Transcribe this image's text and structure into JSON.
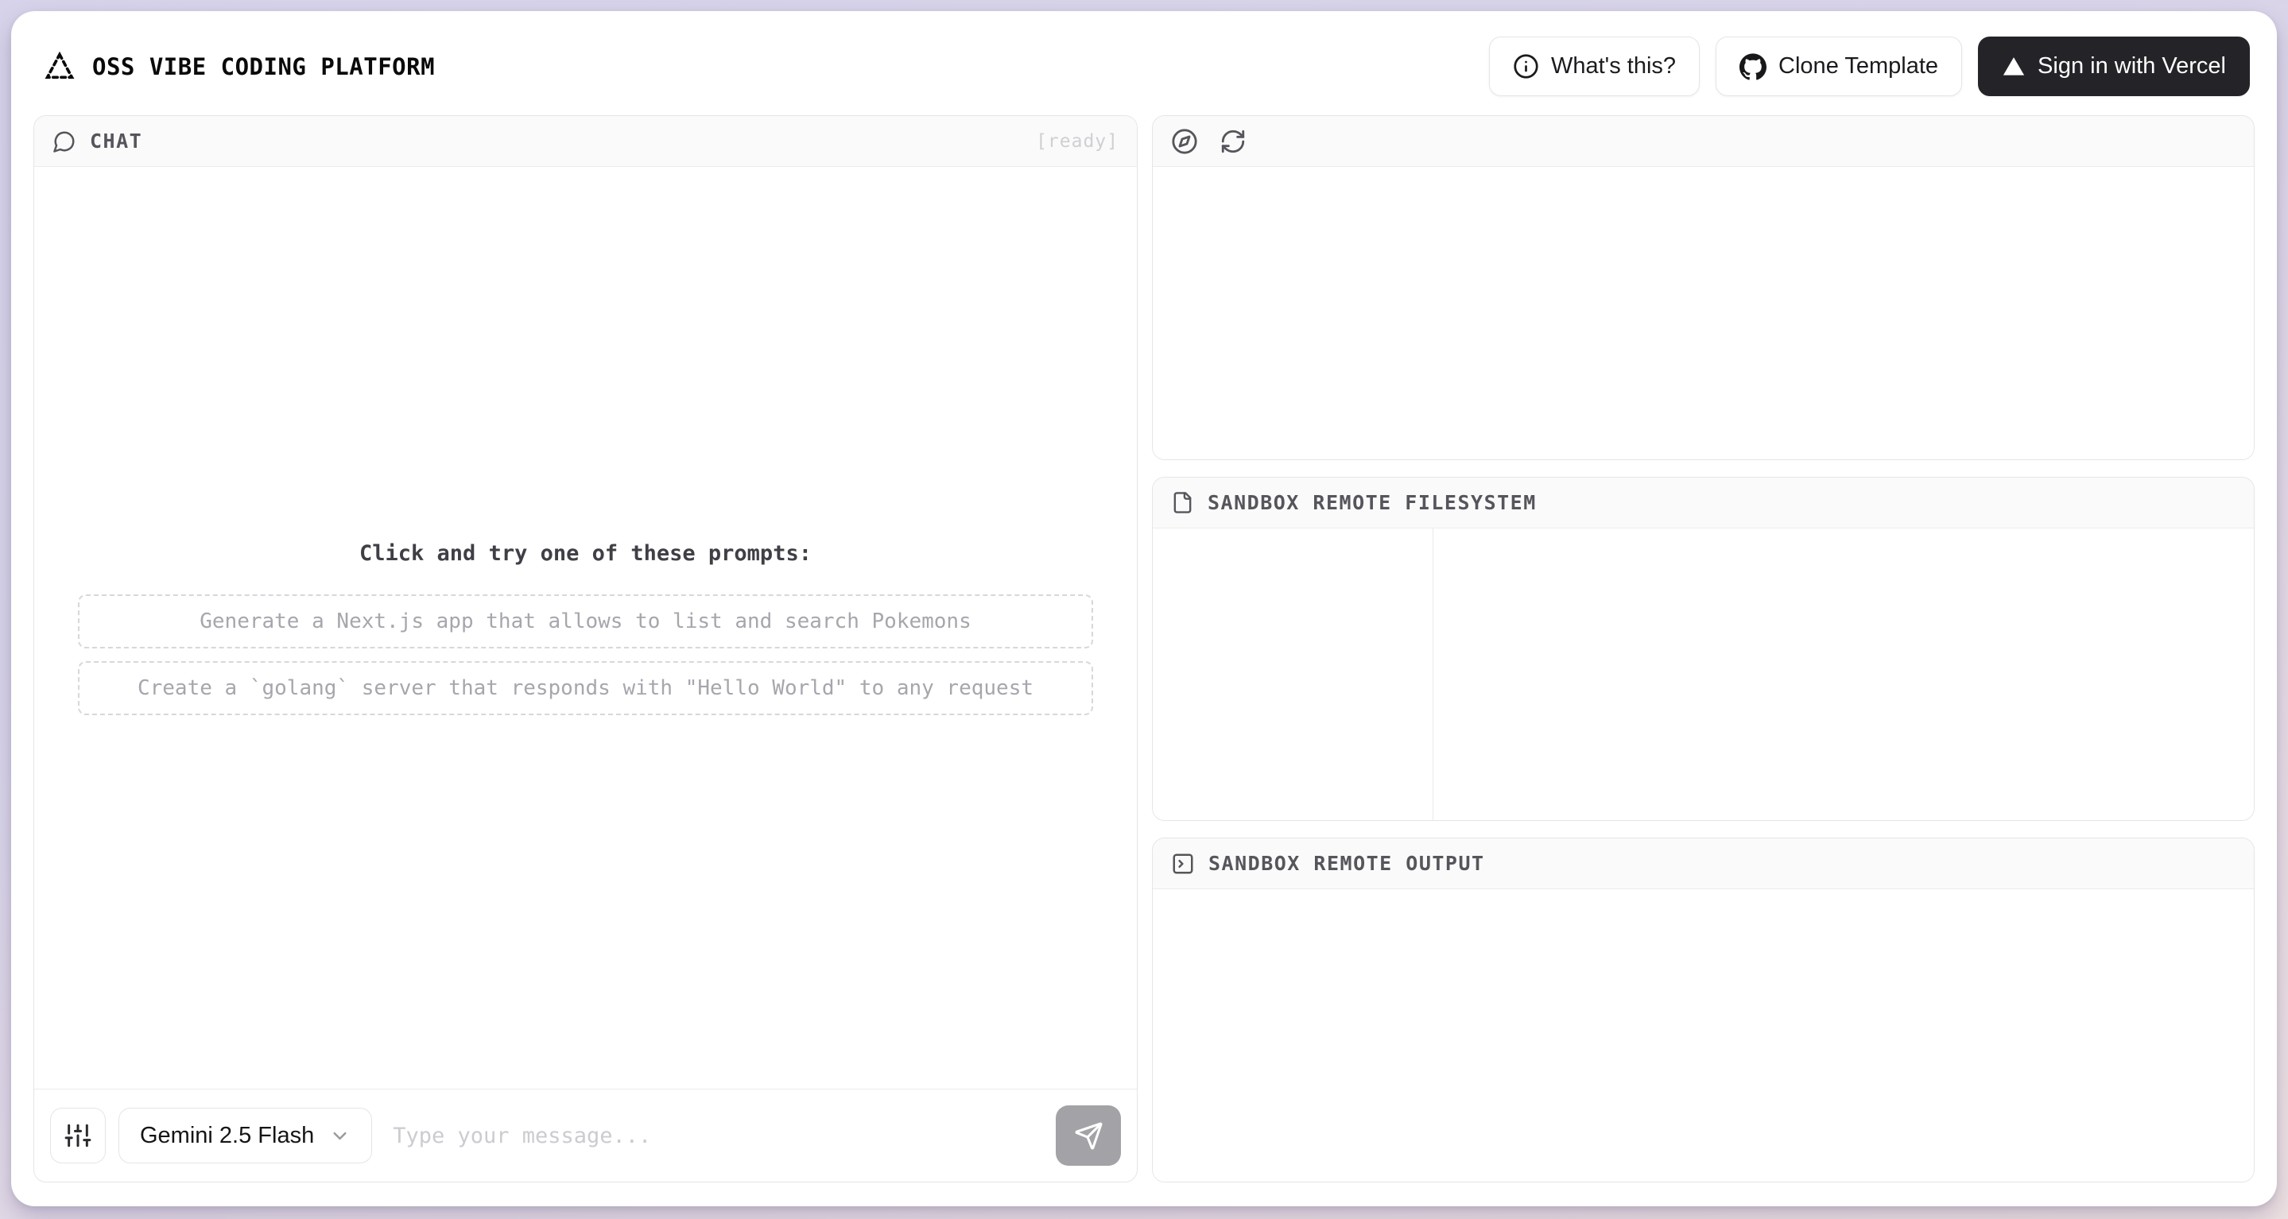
{
  "header": {
    "title": "OSS VIBE CODING PLATFORM",
    "whats_this_label": "What's this?",
    "clone_template_label": "Clone Template",
    "sign_in_label": "Sign in with Vercel"
  },
  "chat": {
    "title": "CHAT",
    "status": "[ready]",
    "prompts_heading": "Click and try one of these prompts:",
    "prompts": [
      "Generate a Next.js app that allows to list and search Pokemons",
      "Create a `golang` server that responds with \"Hello World\" to any request"
    ],
    "model_selector": "Gemini 2.5 Flash",
    "input_placeholder": "Type your message..."
  },
  "panels": {
    "preview": {
      "icons": [
        "compass-icon",
        "refresh-icon"
      ]
    },
    "filesystem": {
      "title": "SANDBOX REMOTE FILESYSTEM"
    },
    "output": {
      "title": "SANDBOX REMOTE OUTPUT"
    }
  },
  "icons": {
    "logo": "dashed-triangle",
    "whats_this": "info-circle",
    "clone_template": "github-mark",
    "sign_in": "vercel-filled-triangle",
    "chat": "speech-bubble",
    "preview_navigate": "compass",
    "preview_refresh": "refresh-arrows",
    "filesystem": "file-document",
    "output": "terminal-square",
    "model_settings": "vertical-sliders",
    "model_dropdown": "chevron-down",
    "send": "paper-plane"
  },
  "colors": {
    "page_gradient_start": "#d6d3ea",
    "page_gradient_end": "#eee1e2",
    "sign_in_bg": "#242428",
    "panel_border": "#e5e5e8",
    "panel_header_bg": "#fafafa",
    "muted_text": "#55555c",
    "status_text": "#cfcfd4",
    "prompt_text": "#a6a6ad",
    "placeholder_text": "#cbcbd1",
    "send_button_bg": "#a2a2a7"
  }
}
